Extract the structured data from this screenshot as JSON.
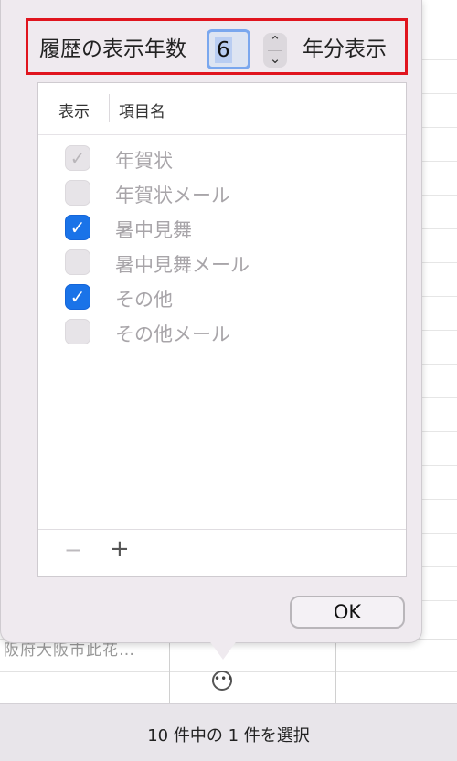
{
  "history": {
    "label": "履歴の表示年数",
    "value": "6",
    "suffix": "年分表示",
    "stepper_up": "⌃",
    "stepper_down": "⌄"
  },
  "list": {
    "header_show": "表示",
    "header_name": "項目名",
    "items": [
      {
        "label": "年賀状",
        "checked": true,
        "disabled": true
      },
      {
        "label": "年賀状メール",
        "checked": false,
        "disabled": true
      },
      {
        "label": "暑中見舞",
        "checked": true,
        "disabled": false
      },
      {
        "label": "暑中見舞メール",
        "checked": false,
        "disabled": true
      },
      {
        "label": "その他",
        "checked": true,
        "disabled": false
      },
      {
        "label": "その他メール",
        "checked": false,
        "disabled": true
      }
    ],
    "minus_label": "−",
    "plus_label": "+"
  },
  "ok_label": "OK",
  "background_cell_text": "阪府大阪市此花…",
  "more_icon_glyph": "•••",
  "status_text": "10 件中の 1 件を選択",
  "colors": {
    "highlight": "#e0141e",
    "accent": "#1a73e8"
  }
}
